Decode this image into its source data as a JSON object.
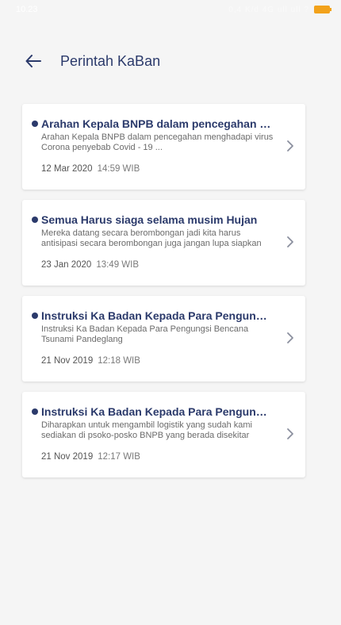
{
  "status_bar": {
    "time": "10.23",
    "indicators": "0,4 K/d  4G ull ull ?",
    "battery_color": "#f2a21b"
  },
  "header": {
    "title": "Perintah KaBan",
    "back_icon": "arrow-left-icon"
  },
  "colors": {
    "primary": "#2b3a6b",
    "background": "#f5f5f5",
    "card": "#ffffff"
  },
  "items": [
    {
      "title": "Arahan Kepala BNPB dalam pencegahan menghad...",
      "description": "Arahan Kepala BNPB dalam pencegahan menghadapi virus Corona penyebab Covid - 19 ...",
      "date": "12 Mar 2020",
      "time": "14:59 WIB"
    },
    {
      "title": "Semua Harus siaga selama musim Hujan",
      "description": "Mereka datang secara berombongan jadi kita harus antisipasi secara berombongan juga jangan lupa siapkan alat dan bahan ...",
      "date": "23 Jan 2020",
      "time": "13:49 WIB"
    },
    {
      "title": "Instruksi Ka Badan Kepada Para Pengungsi Benca...",
      "description": "Instruksi Ka Badan Kepada Para Pengungsi Bencana Tsunami Pandeglang",
      "date": "21 Nov 2019",
      "time": "12:18 WIB"
    },
    {
      "title": "Instruksi Ka Badan Kepada Para Pengungsi Benca...",
      "description": "Diharapkan untuk mengambil logistik yang sudah kami sediakan di psoko-posko BNPB yang berada disekitar lokasi b...",
      "date": "21 Nov 2019",
      "time": "12:17 WIB"
    }
  ]
}
